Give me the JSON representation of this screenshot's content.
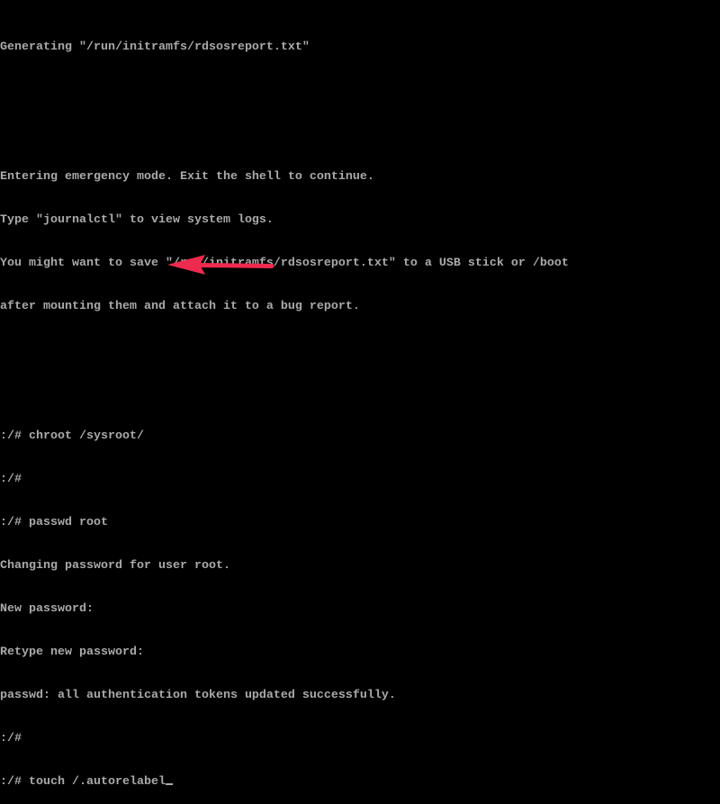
{
  "terminal": {
    "lines": [
      "Generating \"/run/initramfs/rdsosreport.txt\"",
      "",
      "",
      "Entering emergency mode. Exit the shell to continue.",
      "Type \"journalctl\" to view system logs.",
      "You might want to save \"/run/initramfs/rdsosreport.txt\" to a USB stick or /boot",
      "after mounting them and attach it to a bug report.",
      "",
      "",
      ":/# chroot /sysroot/",
      ":/#",
      ":/# passwd root",
      "Changing password for user root.",
      "New password:",
      "Retype new password:",
      "passwd: all authentication tokens updated successfully.",
      ":/#",
      ":/# touch /.autorelabel"
    ]
  },
  "annotation": {
    "icon": "arrow-left-icon",
    "color": "#ee2a4e"
  }
}
